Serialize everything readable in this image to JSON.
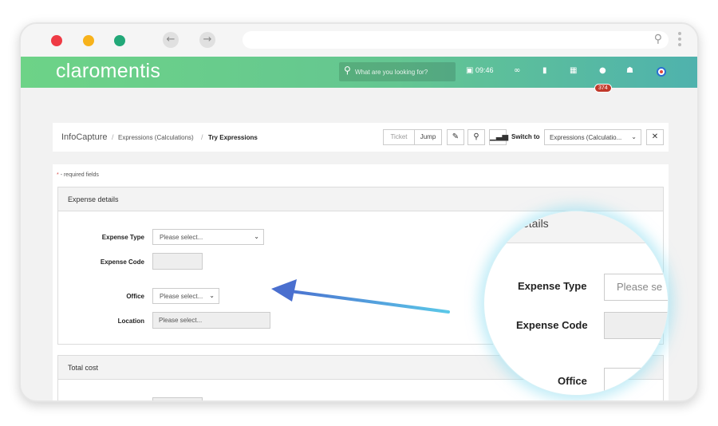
{
  "browser": {
    "dots": [
      "#ef3b45",
      "#f7b21b",
      "#22a878"
    ],
    "back_icon": "arrow-left-icon",
    "forward_icon": "arrow-right-icon"
  },
  "header": {
    "logo": "claromentis",
    "search_placeholder": "What are you looking for?",
    "time": "09:46",
    "notification_count": "374",
    "colors": {
      "gradient_start": "#6dd387",
      "gradient_end": "#4fb2ad"
    }
  },
  "toolbar": {
    "breadcrumb": {
      "root": "InfoCapture",
      "middle": "Expressions (Calculations)",
      "current": "Try Expressions"
    },
    "ticket_placeholder": "Ticket",
    "jump_label": "Jump",
    "switch_label": "Switch to",
    "switch_value": "Expressions (Calculatio..."
  },
  "form": {
    "required_note": "- required fields",
    "sections": {
      "expense_title": "Expense details",
      "total_title": "Total cost"
    },
    "fields": {
      "expense_type_label": "Expense Type",
      "expense_type_value": "Please select...",
      "expense_code_label": "Expense Code",
      "office_label": "Office",
      "office_value": "Please select...",
      "location_label": "Location",
      "location_value": "Please select..."
    }
  },
  "zoom": {
    "header_fragment": "etails",
    "expense_type_label": "Expense Type",
    "expense_type_value": "Please se",
    "expense_code_label": "Expense Code",
    "office_label": "Office"
  }
}
